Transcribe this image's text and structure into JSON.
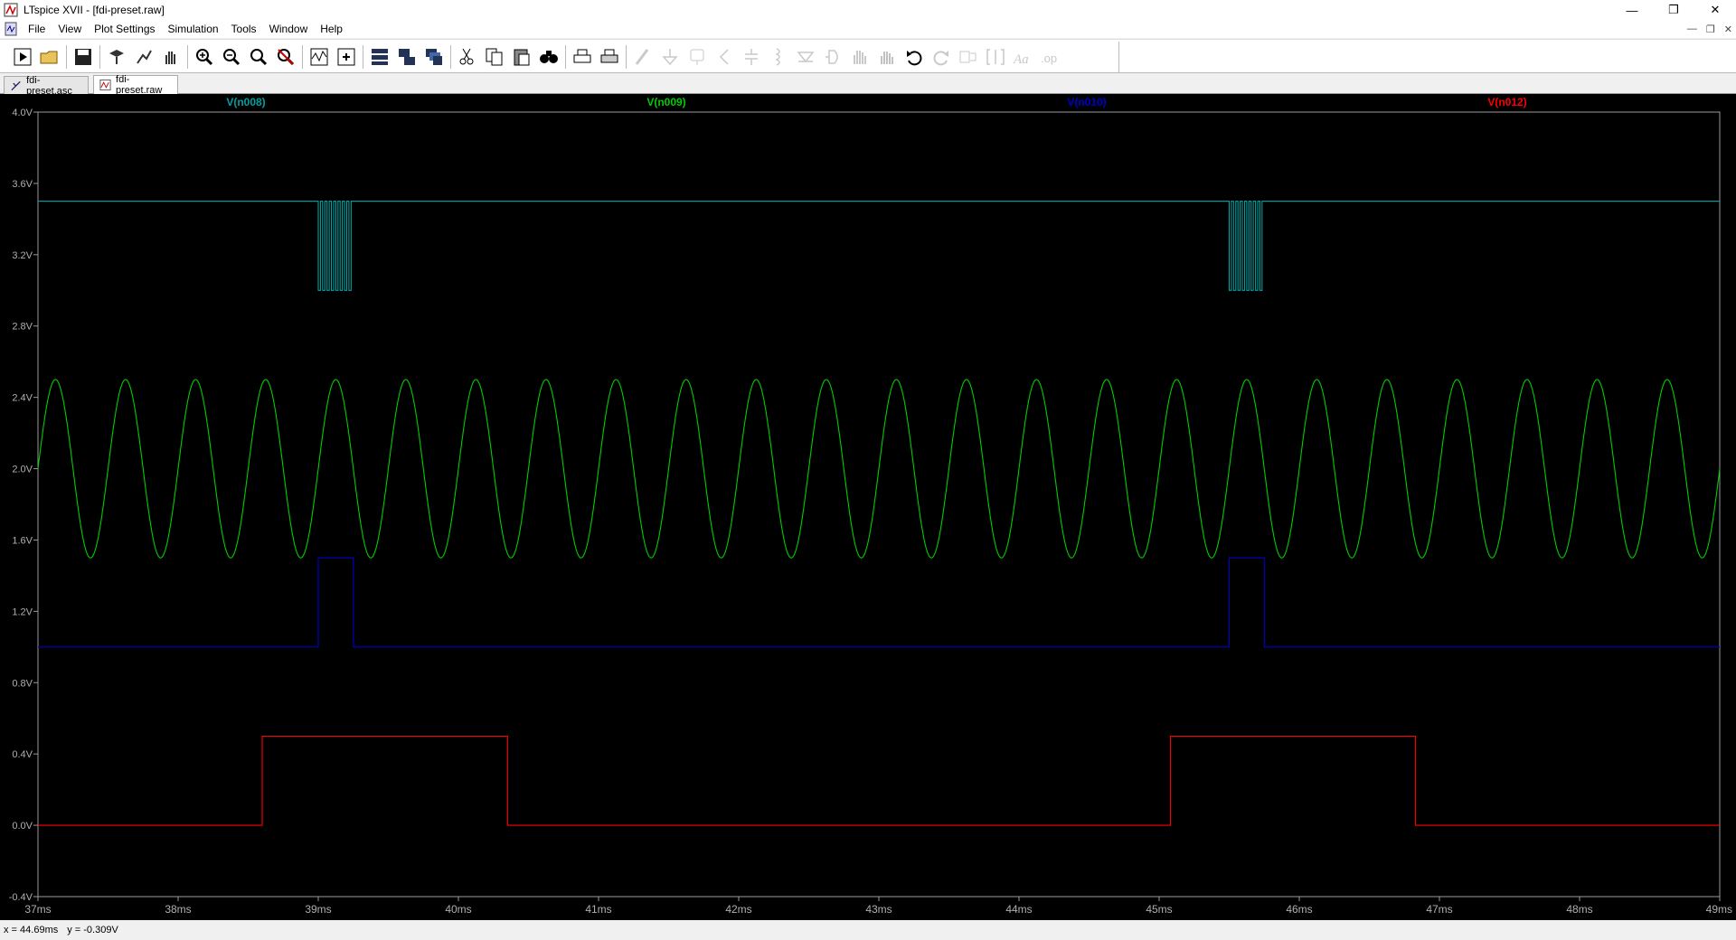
{
  "window": {
    "title": "LTspice XVII - [fdi-preset.raw]",
    "minimize_icon": "minimize-icon",
    "restore_icon": "restore-icon",
    "close_icon": "close-icon"
  },
  "menu": {
    "items": [
      "File",
      "View",
      "Plot Settings",
      "Simulation",
      "Tools",
      "Window",
      "Help"
    ]
  },
  "toolbar": {
    "icons": [
      "run-icon",
      "open-icon",
      "save-icon",
      "control-panel-icon",
      "halt-icon",
      "pan-icon",
      "zoom-in-icon",
      "zoom-out-icon",
      "zoom-back-icon",
      "zoom-fit-icon",
      "autorange-icon",
      "add-trace-icon",
      "tile-horizontal-icon",
      "tile-vertical-icon",
      "cascade-icon",
      "cut-icon",
      "copy-icon",
      "paste-icon",
      "find-icon",
      "print-icon",
      "print-preview-icon",
      "wire-icon",
      "ground-icon",
      "label-icon",
      "resistor-icon",
      "capacitor-icon",
      "inductor-icon",
      "diode-icon",
      "component-icon",
      "move-icon",
      "drag-icon",
      "undo-icon",
      "redo-icon",
      "rotate-icon",
      "mirror-icon",
      "text-icon",
      "spice-directive-icon"
    ]
  },
  "tabs": [
    {
      "label": "fdi-preset.asc",
      "icon": "schematic-icon",
      "active": false
    },
    {
      "label": "fdi-preset.raw",
      "icon": "waveform-icon",
      "active": true
    }
  ],
  "status": {
    "x_readout": "x = 44.69ms",
    "y_readout": "y = -0.309V"
  },
  "chart_data": {
    "type": "line",
    "title": "",
    "xlabel": "",
    "ylabel": "",
    "xlim": [
      37,
      49
    ],
    "ylim": [
      -0.4,
      4.0
    ],
    "x_unit": "ms",
    "y_unit": "V",
    "x_ticks": [
      "37ms",
      "38ms",
      "39ms",
      "40ms",
      "41ms",
      "42ms",
      "43ms",
      "44ms",
      "45ms",
      "46ms",
      "47ms",
      "48ms",
      "49ms"
    ],
    "y_ticks": [
      "4.0V",
      "3.6V",
      "3.2V",
      "2.8V",
      "2.4V",
      "2.0V",
      "1.6V",
      "1.2V",
      "0.8V",
      "0.4V",
      "0.0V",
      "-0.4V"
    ],
    "grid": false,
    "legend": "top",
    "series": [
      {
        "name": "V(n008)",
        "color": "#00a0a0",
        "kind": "square-with-bursts",
        "base": 3.5,
        "low": 3.0,
        "bursts": [
          [
            39.0,
            39.25
          ],
          [
            45.5,
            45.75
          ]
        ],
        "burst_cycles": 8
      },
      {
        "name": "V(n009)",
        "color": "#00cc00",
        "kind": "sine",
        "offset": 2.0,
        "amplitude": 0.5,
        "period_ms": 0.5,
        "phase_start": 37.0,
        "phase_start_value": 2.0
      },
      {
        "name": "V(n010)",
        "color": "#0000cc",
        "kind": "pulse",
        "points": [
          [
            37.0,
            1.0
          ],
          [
            39.0,
            1.0
          ],
          [
            39.0,
            1.5
          ],
          [
            39.25,
            1.5
          ],
          [
            39.25,
            1.0
          ],
          [
            45.5,
            1.0
          ],
          [
            45.5,
            1.5
          ],
          [
            45.75,
            1.5
          ],
          [
            45.75,
            1.0
          ],
          [
            49.0,
            1.0
          ]
        ]
      },
      {
        "name": "V(n012)",
        "color": "#ff0000",
        "kind": "pulse",
        "points": [
          [
            37.0,
            0.0
          ],
          [
            38.6,
            0.0
          ],
          [
            38.6,
            0.5
          ],
          [
            40.35,
            0.5
          ],
          [
            40.35,
            0.0
          ],
          [
            45.08,
            0.0
          ],
          [
            45.08,
            0.5
          ],
          [
            46.83,
            0.5
          ],
          [
            46.83,
            0.0
          ],
          [
            49.0,
            0.0
          ]
        ]
      }
    ]
  }
}
